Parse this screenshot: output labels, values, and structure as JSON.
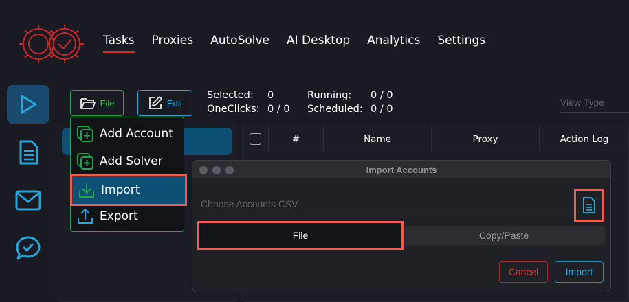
{
  "nav": {
    "items": [
      {
        "label": "Tasks",
        "active": true
      },
      {
        "label": "Proxies"
      },
      {
        "label": "AutoSolve"
      },
      {
        "label": "AI Desktop"
      },
      {
        "label": "Analytics"
      },
      {
        "label": "Settings"
      }
    ]
  },
  "sidebar": {
    "items": [
      {
        "icon": "play-icon",
        "active": true
      },
      {
        "icon": "document-icon"
      },
      {
        "icon": "mail-icon"
      },
      {
        "icon": "chat-check-icon"
      }
    ]
  },
  "toolbar": {
    "file_label": "File",
    "edit_label": "Edit"
  },
  "stats": {
    "selected_label": "Selected:",
    "selected_value": "0",
    "oneclicks_label": "OneClicks:",
    "oneclicks_value": "0 / 0",
    "running_label": "Running:",
    "running_value": "0 / 0",
    "scheduled_label": "Scheduled:",
    "scheduled_value": "0 / 0"
  },
  "view_type": {
    "placeholder": "View Type"
  },
  "table": {
    "columns": [
      "#",
      "Name",
      "Proxy",
      "Action Log"
    ]
  },
  "file_menu": {
    "items": [
      {
        "label": "Add Account",
        "icon": "add-account-icon"
      },
      {
        "label": "Add Solver",
        "icon": "add-solver-icon"
      },
      {
        "label": "Import",
        "icon": "import-icon",
        "selected": true
      },
      {
        "label": "Export",
        "icon": "export-icon"
      }
    ]
  },
  "dialog": {
    "title": "Import Accounts",
    "csv_placeholder": "Choose Accounts CSV",
    "tab_file": "File",
    "tab_copy": "Copy/Paste",
    "cancel_label": "Cancel",
    "import_label": "Import"
  },
  "colors": {
    "accent_red": "#d42a2a",
    "accent_blue": "#27a4d8",
    "accent_green": "#1fa64a",
    "highlight": "#f05a4f"
  }
}
